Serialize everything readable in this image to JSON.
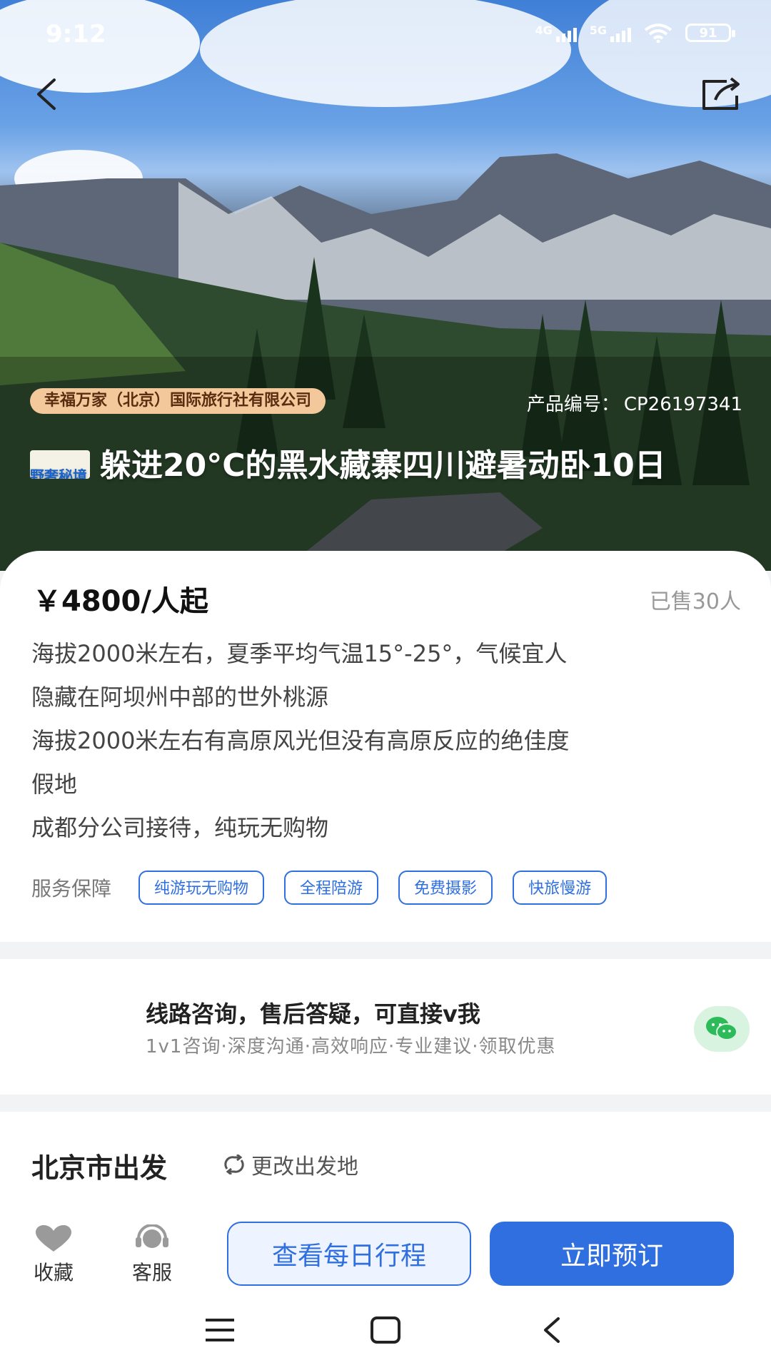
{
  "status_bar": {
    "time": "9:12",
    "network1": "4G",
    "network2": "5G",
    "battery": "91"
  },
  "hero": {
    "agency": "幸福万家（北京）国际旅行社有限公司",
    "product_code_label": "产品编号：",
    "product_code": "CP26197341",
    "brand_logo_text": "野奢秘境",
    "title": "躲进20°C的黑水藏寨四川避暑动卧10日"
  },
  "product": {
    "price": "￥4800/人起",
    "sold": "已售30人",
    "description": [
      "海拔2000米左右，夏季平均气温15°-25°，气候宜人",
      "隐藏在阿坝州中部的世外桃源",
      "海拔2000米左右有高原风光但没有高原反应的绝佳度",
      "假地",
      "成都分公司接待，纯玩无购物"
    ],
    "service_label": "服务保障",
    "service_tags": [
      "纯游玩无购物",
      "全程陪游",
      "免费摄影",
      "快旅慢游"
    ]
  },
  "consult": {
    "title": "线路咨询，售后答疑，可直接v我",
    "subtitle": "1v1咨询·深度沟通·高效响应·专业建议·领取优惠",
    "icon": "wechat-icon"
  },
  "departure": {
    "title": "北京市出发",
    "change_label": "更改出发地"
  },
  "bottom_bar": {
    "favorite": "收藏",
    "service": "客服",
    "itinerary_button": "查看每日行程",
    "book_button": "立即预订"
  },
  "colors": {
    "primary": "#2f6fe0",
    "badge_bg": "#f3c89a",
    "wechat": "#2dbb5a"
  }
}
